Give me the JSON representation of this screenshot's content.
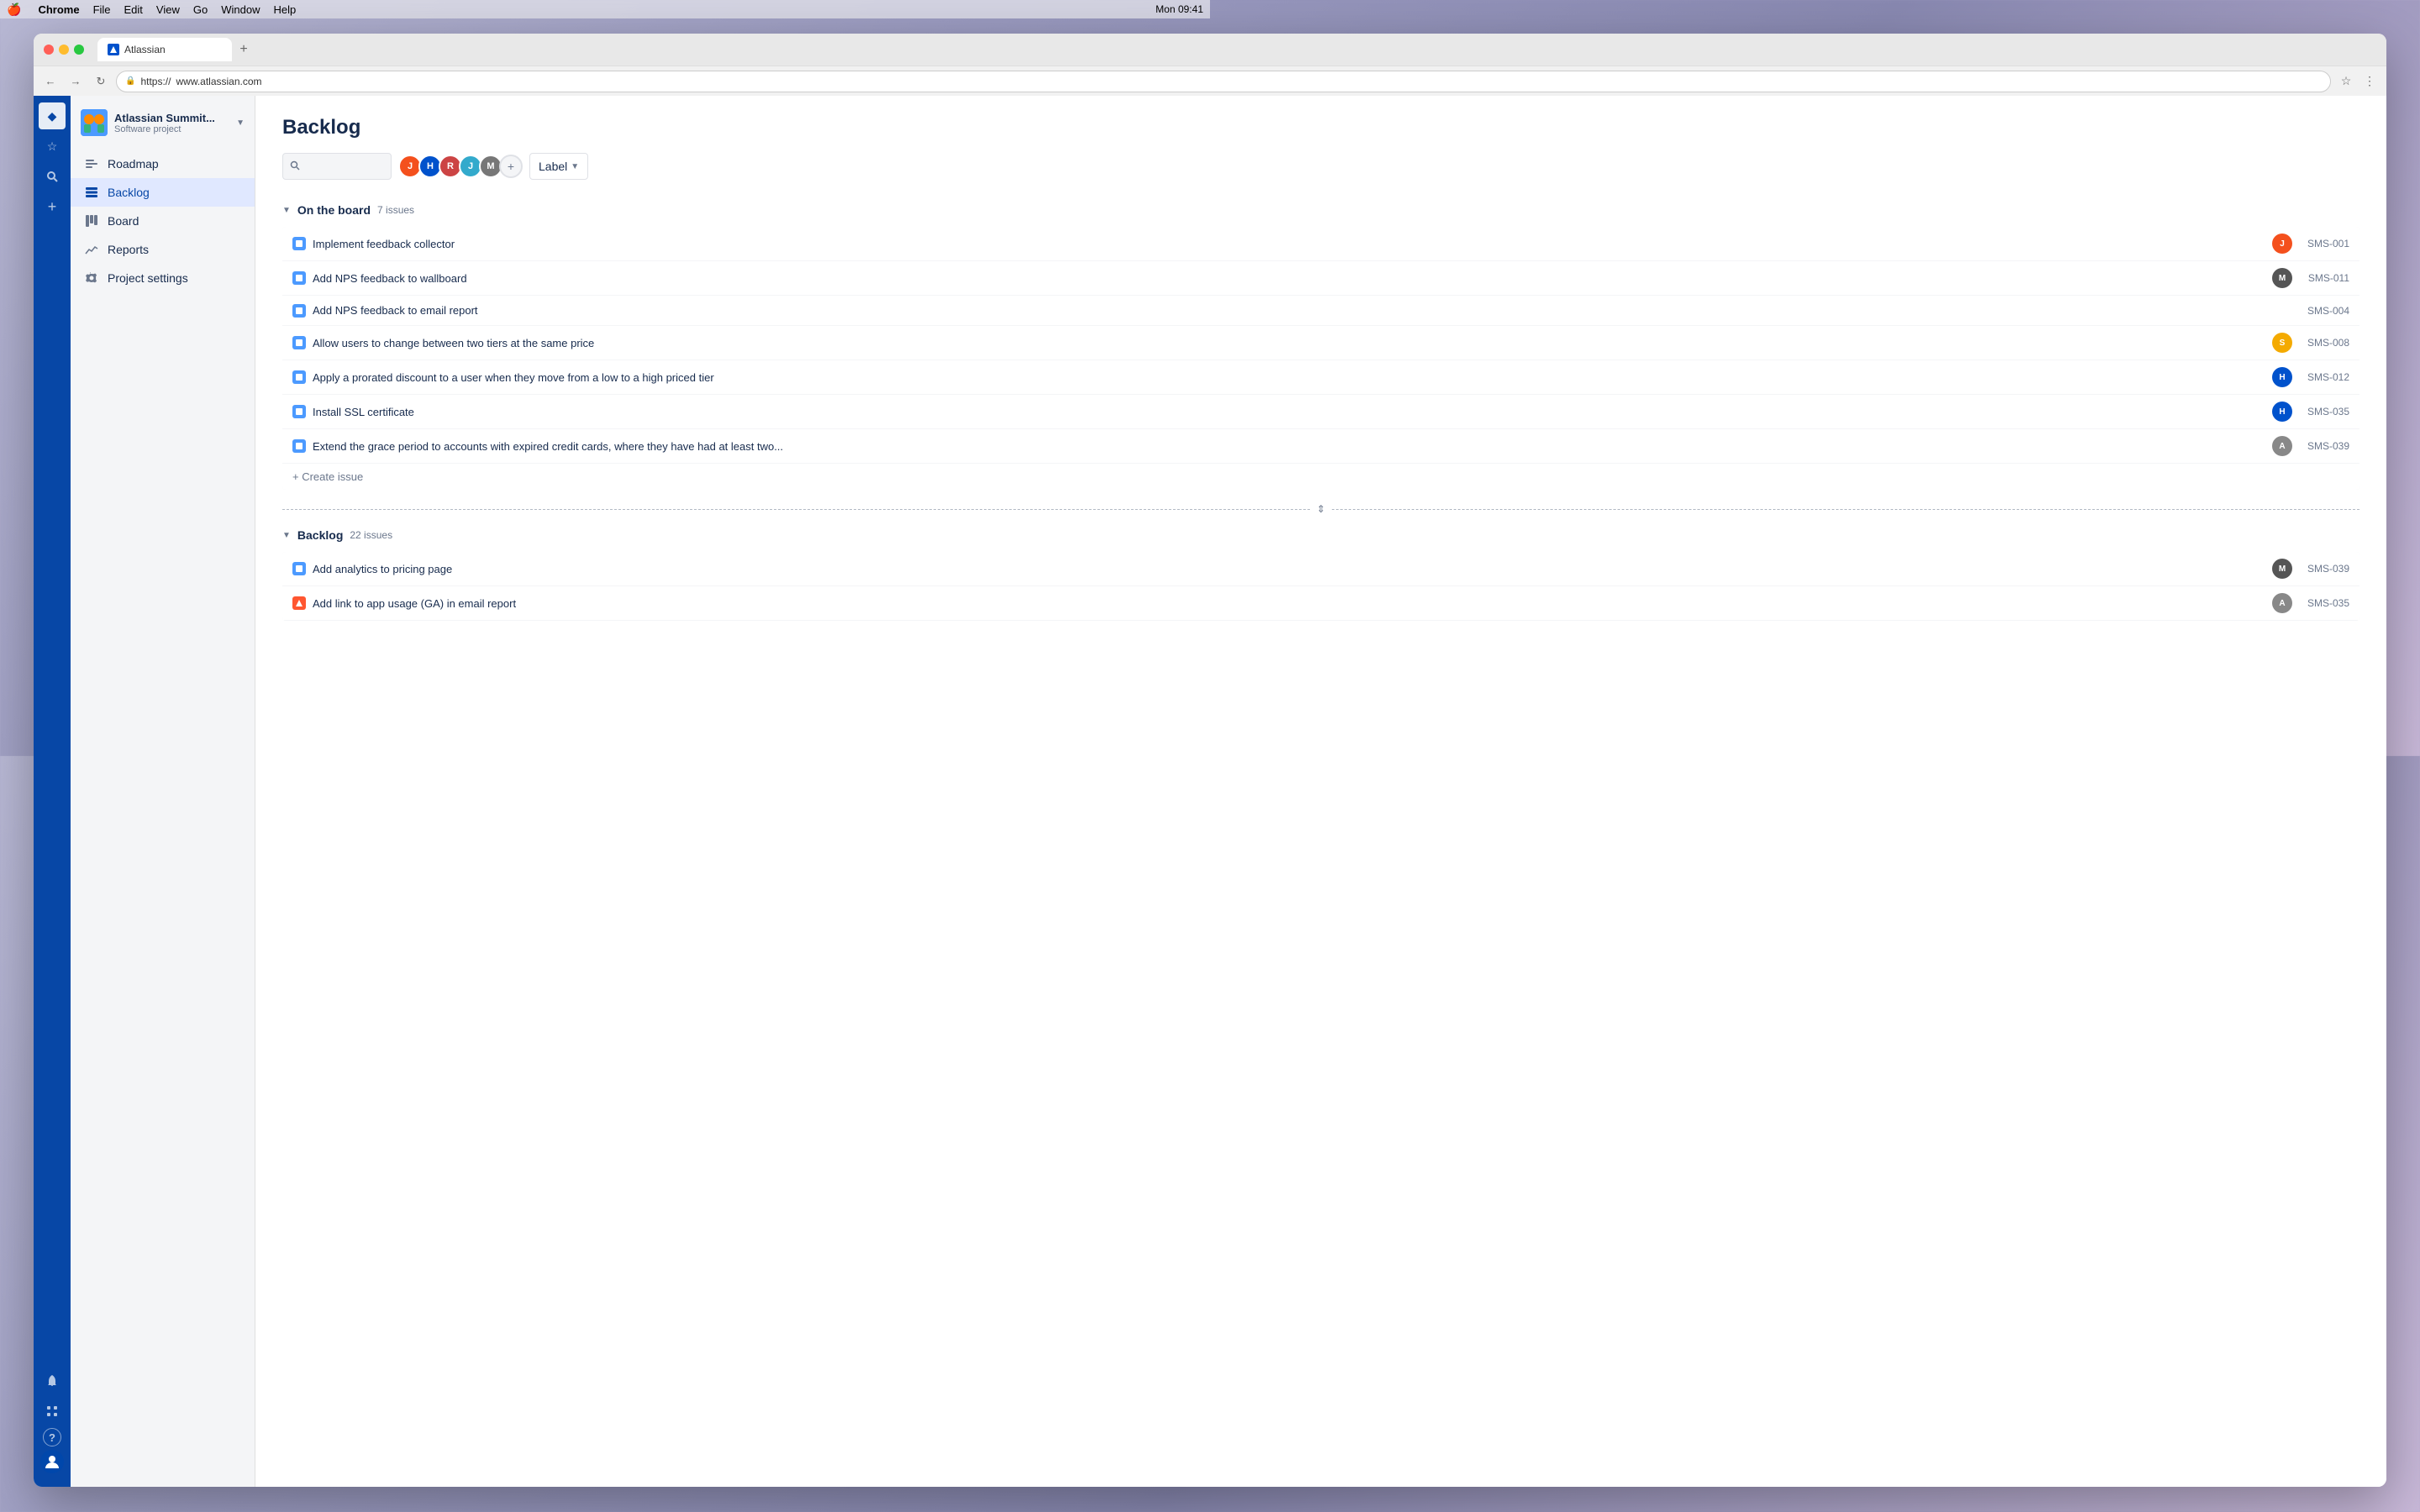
{
  "menubar": {
    "apple": "🍎",
    "items": [
      "Chrome",
      "File",
      "Edit",
      "View",
      "Go",
      "Window",
      "Help"
    ],
    "time": "Mon 09:41",
    "chrome_app": "Chrome"
  },
  "browser": {
    "tab_title": "Atlassian",
    "tab_favicon_text": "A",
    "url_protocol": "https://",
    "url_domain": "www.atlassian.com",
    "add_tab_label": "+"
  },
  "nav_rail": {
    "items": [
      {
        "name": "home",
        "icon": "◆",
        "active": true
      },
      {
        "name": "star",
        "icon": "☆"
      },
      {
        "name": "search",
        "icon": "🔍"
      },
      {
        "name": "plus",
        "icon": "+"
      },
      {
        "name": "bell",
        "icon": "🔔"
      },
      {
        "name": "grid",
        "icon": "⊞"
      },
      {
        "name": "help",
        "icon": "?"
      },
      {
        "name": "avatar",
        "icon": "👤"
      }
    ]
  },
  "sidebar": {
    "project_name": "Atlassian Summit...",
    "project_type": "Software project",
    "nav_items": [
      {
        "id": "roadmap",
        "label": "Roadmap",
        "icon": "≡"
      },
      {
        "id": "backlog",
        "label": "Backlog",
        "icon": "☰",
        "active": true
      },
      {
        "id": "board",
        "label": "Board",
        "icon": "⊞"
      },
      {
        "id": "reports",
        "label": "Reports",
        "icon": "📈"
      },
      {
        "id": "project-settings",
        "label": "Project settings",
        "icon": "⚙"
      }
    ]
  },
  "main": {
    "page_title": "Backlog",
    "toolbar": {
      "search_placeholder": "",
      "label_dropdown": "Label",
      "add_avatar_icon": "+"
    },
    "sections": [
      {
        "id": "on-the-board",
        "title": "On the board",
        "count": "7 issues",
        "issues": [
          {
            "id": "SMS-001",
            "title": "Implement feedback collector",
            "type": "story",
            "assignee_color": "#f4501d",
            "assignee_letter": "J"
          },
          {
            "id": "SMS-011",
            "title": "Add NPS feedback to wallboard",
            "type": "task",
            "assignee_color": "#555",
            "assignee_letter": "M"
          },
          {
            "id": "SMS-004",
            "title": "Add NPS feedback to email report",
            "type": "task",
            "assignee_color": null,
            "assignee_letter": ""
          },
          {
            "id": "SMS-008",
            "title": "Allow users to change between two tiers at the same price",
            "type": "task",
            "assignee_color": "#f4aa00",
            "assignee_letter": "S"
          },
          {
            "id": "SMS-012",
            "title": "Apply a prorated discount to a user when they move from a low to a high priced tier",
            "type": "task",
            "assignee_color": "#0052cc",
            "assignee_letter": "H"
          },
          {
            "id": "SMS-035",
            "title": "Install SSL certificate",
            "type": "task",
            "assignee_color": "#0052cc",
            "assignee_letter": "H"
          },
          {
            "id": "SMS-039",
            "title": "Extend the grace period to accounts with expired credit cards, where they have had at least two...",
            "type": "task",
            "assignee_color": "#888",
            "assignee_letter": "A"
          }
        ],
        "create_label": "+ Create issue"
      },
      {
        "id": "backlog",
        "title": "Backlog",
        "count": "22 issues",
        "issues": [
          {
            "id": "SMS-039",
            "title": "Add analytics to pricing page",
            "type": "task",
            "assignee_color": "#555",
            "assignee_letter": "M"
          },
          {
            "id": "SMS-035",
            "title": "Add link to app usage (GA) in email report",
            "type": "bug",
            "assignee_color": "#888",
            "assignee_letter": "A"
          }
        ]
      }
    ]
  },
  "avatars": [
    {
      "color": "#f4501d",
      "letter": "J"
    },
    {
      "color": "#0052cc",
      "letter": "H"
    },
    {
      "color": "#cc4444",
      "letter": "R"
    },
    {
      "color": "#33aacc",
      "letter": "J"
    },
    {
      "color": "#888",
      "letter": "M"
    }
  ]
}
